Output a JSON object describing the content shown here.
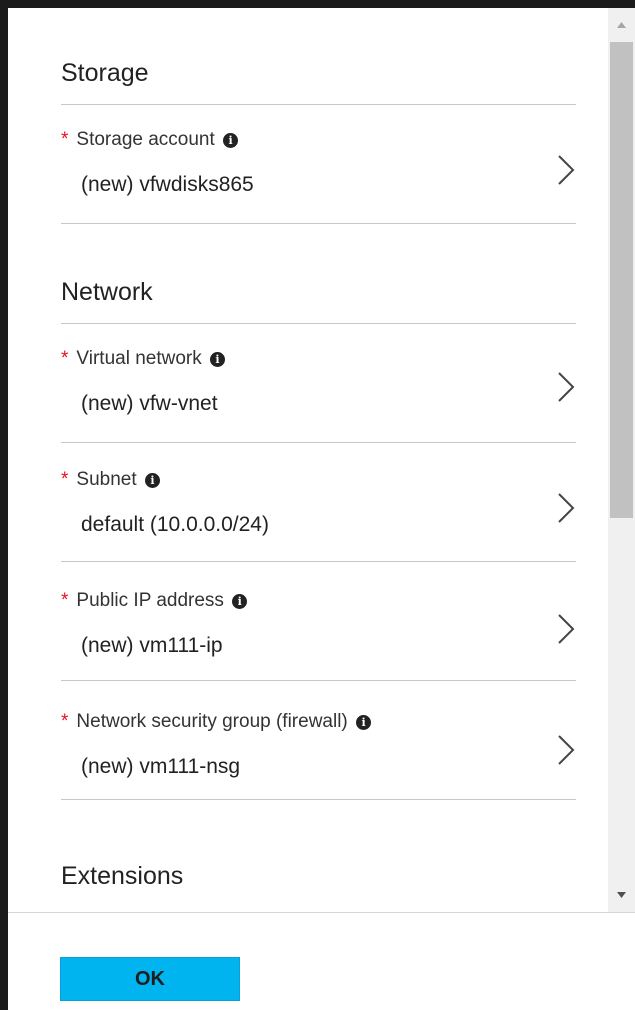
{
  "sections": {
    "storage": {
      "title": "Storage",
      "fields": [
        {
          "label": "Storage account",
          "value": "(new) vfwdisks865",
          "required": "*",
          "info": "i"
        }
      ]
    },
    "network": {
      "title": "Network",
      "fields": [
        {
          "label": "Virtual network",
          "value": "(new) vfw-vnet",
          "required": "*",
          "info": "i"
        },
        {
          "label": "Subnet",
          "value": "default (10.0.0.0/24)",
          "required": "*",
          "info": "i"
        },
        {
          "label": "Public IP address",
          "value": "(new) vm111-ip",
          "required": "*",
          "info": "i"
        },
        {
          "label": "Network security group (firewall)",
          "value": "(new) vm111-nsg",
          "required": "*",
          "info": "i"
        }
      ]
    },
    "extensions": {
      "title": "Extensions"
    }
  },
  "footer": {
    "ok_label": "OK"
  },
  "colors": {
    "required": "#e81123",
    "ok_button": "#00b4f0",
    "divider": "#c8c8c8",
    "scroll_thumb": "#c1c1c1"
  },
  "icons": {
    "chevron": "chevron-right-icon",
    "info": "info-icon",
    "scroll_up": "arrow-up-icon",
    "scroll_down": "arrow-down-icon"
  }
}
